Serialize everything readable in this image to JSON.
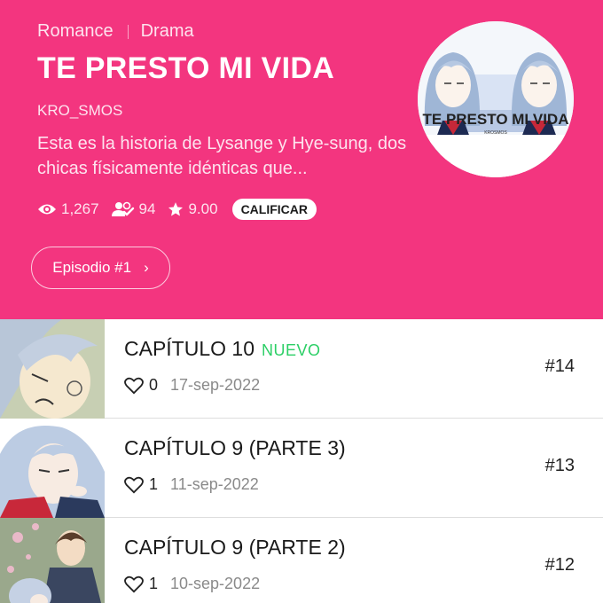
{
  "series": {
    "genres": [
      "Romance",
      "Drama"
    ],
    "title": "TE PRESTO MI VIDA",
    "author": "KRO_SMOS",
    "synopsis": "Esta es la historia de Lysange y Hye-sung, dos chicas físicamente idénticas que...",
    "cover_title": "TE PRESTO MI VIDA",
    "cover_subtitle": "KROSMOS"
  },
  "stats": {
    "views": "1,267",
    "subscribers": "94",
    "rating": "9.00",
    "rate_label": "CALIFICAR",
    "icons": [
      "eye-icon",
      "subscribers-icon",
      "star-icon"
    ]
  },
  "episode_button": {
    "label": "Episodio #1",
    "chevron": "›"
  },
  "episodes": [
    {
      "title": "CAPÍTULO 10",
      "badge": "NUEVO",
      "likes": "0",
      "date": "17-sep-2022",
      "number": "#14"
    },
    {
      "title": "CAPÍTULO 9 (PARTE 3)",
      "badge": "",
      "likes": "1",
      "date": "11-sep-2022",
      "number": "#13"
    },
    {
      "title": "CAPÍTULO 9 (PARTE 2)",
      "badge": "",
      "likes": "1",
      "date": "10-sep-2022",
      "number": "#12"
    }
  ],
  "colors": {
    "header_bg": "#f3357f",
    "new_badge": "#2ccf66",
    "date_text": "#8a8a8a"
  }
}
